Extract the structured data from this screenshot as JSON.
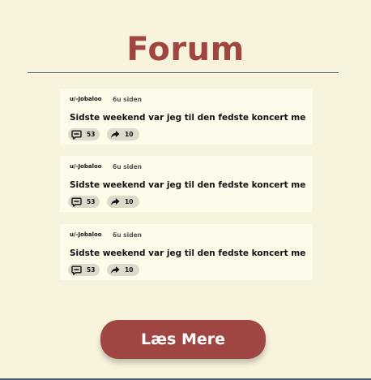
{
  "page": {
    "title": "Forum",
    "read_more_label": "Læs Mere"
  },
  "posts": [
    {
      "user": "u/-Jobaloo",
      "time": "6u siden",
      "text": "Sidste weekend var jeg til den fedste koncert med ...",
      "comments": "53",
      "shares": "10"
    },
    {
      "user": "u/-Jobaloo",
      "time": "6u siden",
      "text": "Sidste weekend var jeg til den fedste koncert med ...",
      "comments": "53",
      "shares": "10"
    },
    {
      "user": "u/-Jobaloo",
      "time": "6u siden",
      "text": "Sidste weekend var jeg til den fedste koncert med ...",
      "comments": "53",
      "shares": "10"
    }
  ],
  "icons": {
    "comment": "comment-icon",
    "share": "share-icon"
  },
  "colors": {
    "background": "#f8f3dd",
    "accent": "#a04642",
    "card": "#fefbea",
    "rule": "#4a5f7a"
  }
}
